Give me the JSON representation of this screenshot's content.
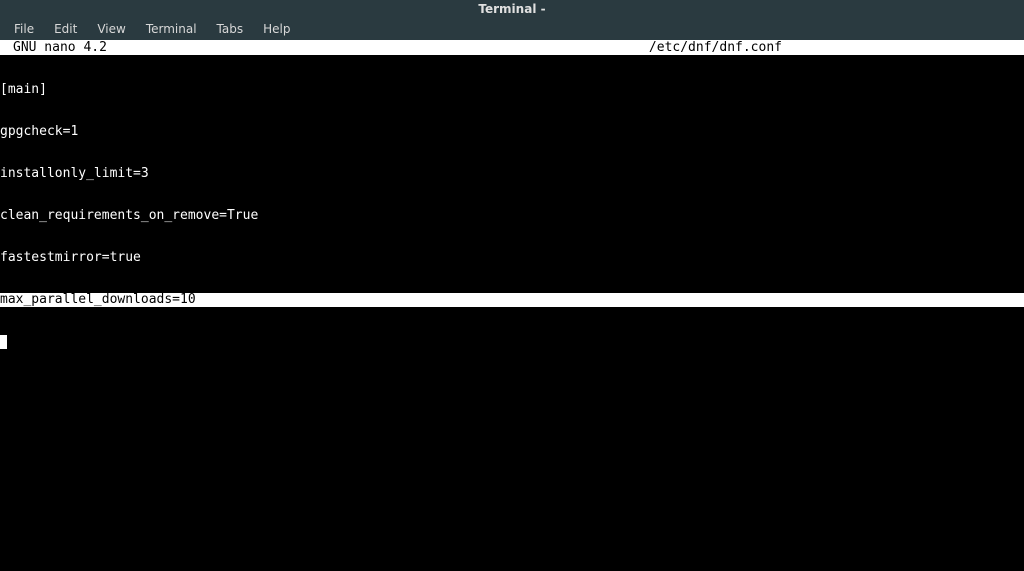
{
  "window": {
    "title": "Terminal -"
  },
  "menu": {
    "file": "File",
    "edit": "Edit",
    "view": "View",
    "terminal": "Terminal",
    "tabs": "Tabs",
    "help": "Help"
  },
  "nano": {
    "app_label": "GNU nano 4.2",
    "file_path": "/etc/dnf/dnf.conf"
  },
  "content": {
    "lines": [
      "[main]",
      "gpgcheck=1",
      "installonly_limit=3",
      "clean_requirements_on_remove=True",
      "fastestmirror=true"
    ],
    "highlighted_line": "max_parallel_downloads=10"
  }
}
